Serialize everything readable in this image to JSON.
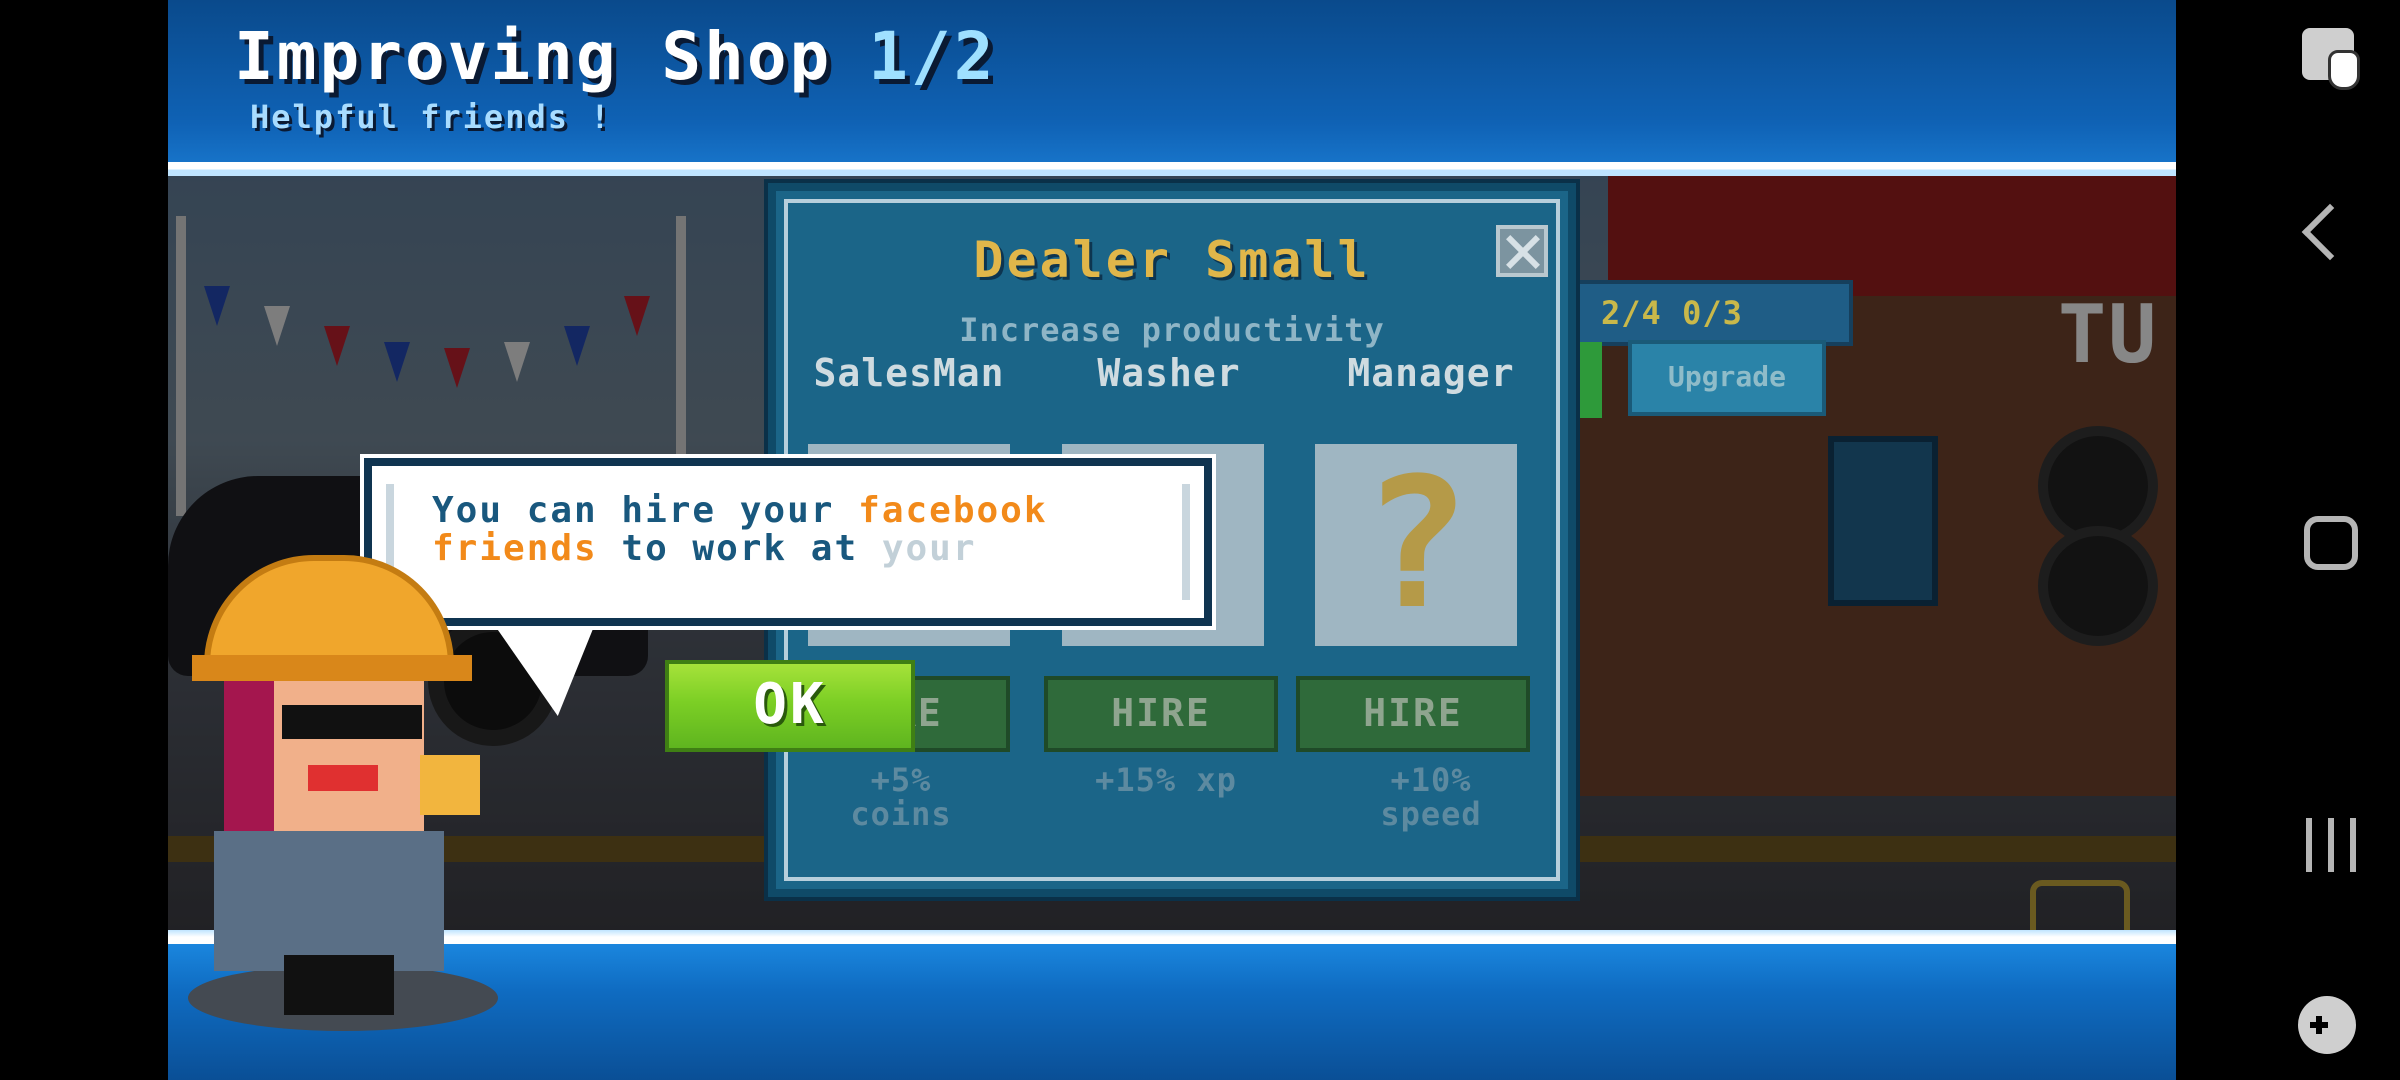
{
  "banner": {
    "title": "Improving Shop",
    "progress": "1/2",
    "subtitle": "Helpful friends !"
  },
  "scene": {
    "stats": "2/4 0/3",
    "upgrade_label": "Upgrade",
    "shop_sign": "TU"
  },
  "dialog": {
    "title": "Dealer Small",
    "subtitle": "Increase productivity",
    "columns": [
      {
        "label": "SalesMan",
        "button": "HIRE",
        "bonus_line1": "+5%",
        "bonus_line2": "coins"
      },
      {
        "label": "Washer",
        "button": "HIRE",
        "bonus_line1": "+15% xp",
        "bonus_line2": ""
      },
      {
        "label": "Manager",
        "button": "HIRE",
        "bonus_line1": "+10%",
        "bonus_line2": "speed",
        "slot_symbol": "?"
      }
    ]
  },
  "bubble": {
    "part1": "You can hire your ",
    "highlight1": "facebook",
    "highlight2": "friends",
    "part2": " to work at ",
    "faded": "your"
  },
  "ok_button": {
    "label": "OK"
  },
  "colors": {
    "accent_orange": "#f28a1a",
    "dialog_title": "#e0b64a",
    "ok_green": "#7ccf25"
  },
  "icons": [
    "close-icon",
    "back-icon",
    "home-icon",
    "recent-apps-icon",
    "screen-touch-icon",
    "game-controller-icon"
  ]
}
